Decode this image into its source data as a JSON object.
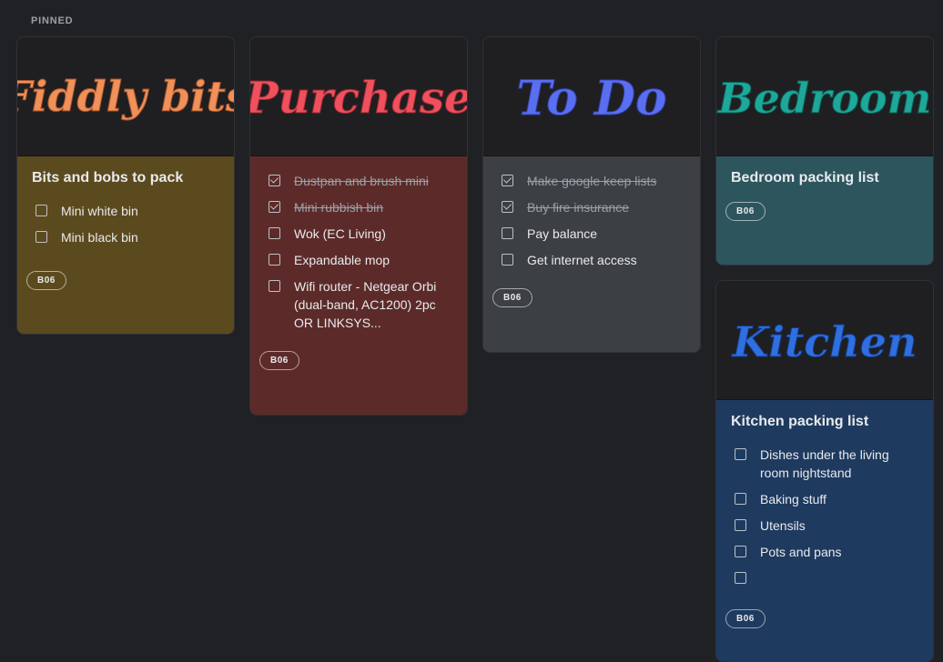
{
  "section": {
    "pinned_label": "PINNED"
  },
  "cards": [
    {
      "banner_text": "Fiddly bits",
      "title": "Bits and bobs to pack",
      "color": "#5c4a1f",
      "banner_color": "#f0915a",
      "items": [
        {
          "text": "Mini white bin",
          "checked": false
        },
        {
          "text": "Mini black bin",
          "checked": false
        }
      ],
      "label": "B06"
    },
    {
      "banner_text": "Purchase",
      "title": "",
      "color": "#5c2b29",
      "banner_color": "#f0505d",
      "items": [
        {
          "text": "Dustpan and brush mini",
          "checked": true
        },
        {
          "text": "Mini rubbish bin",
          "checked": true
        },
        {
          "text": "Wok (EC Living)",
          "checked": false
        },
        {
          "text": "Expandable mop",
          "checked": false
        },
        {
          "text": "Wifi router - Netgear Orbi (dual-band, AC1200) 2pc OR LINKSYS...",
          "checked": false
        }
      ],
      "label": "B06"
    },
    {
      "banner_text": "To Do",
      "title": "",
      "color": "#3c3f43",
      "banner_color": "#5a6ef0",
      "items": [
        {
          "text": "Make google keep lists",
          "checked": true
        },
        {
          "text": "Buy fire insurance",
          "checked": true
        },
        {
          "text": "Pay balance",
          "checked": false
        },
        {
          "text": "Get internet access",
          "checked": false
        }
      ],
      "label": "B06"
    },
    {
      "banner_text": "Bedroom",
      "title": "Bedroom packing list",
      "color": "#2d555e",
      "banner_color": "#1ea89a",
      "items": [],
      "label": "B06"
    },
    {
      "banner_text": "Kitchen",
      "title": "Kitchen packing list",
      "color": "#1e3a5f",
      "banner_color": "#2f6fe0",
      "items": [
        {
          "text": "Dishes under the living room nightstand",
          "checked": false
        },
        {
          "text": "Baking stuff",
          "checked": false
        },
        {
          "text": "Utensils",
          "checked": false
        },
        {
          "text": "Pots and pans",
          "checked": false
        },
        {
          "text": "",
          "checked": false
        }
      ],
      "label": "B06"
    }
  ]
}
